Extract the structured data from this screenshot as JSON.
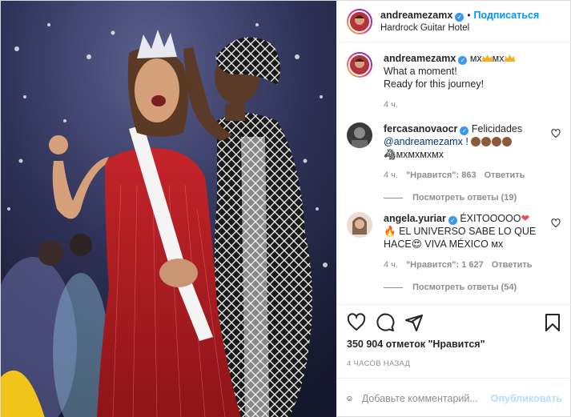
{
  "header": {
    "username": "andreamezamx",
    "separator": "•",
    "follow_label": "Подписаться",
    "location": "Hardrock Guitar Hotel"
  },
  "caption": {
    "username": "andreamezamx",
    "title_text": "мх",
    "title_text2": "мх",
    "line1": "What a moment!",
    "line2": "Ready for this journey!",
    "time": "4 ч."
  },
  "comments": [
    {
      "username": "fercasanovaocr",
      "text_start": "Felicidades",
      "mention": "@andreamezamx",
      "text_after": " !",
      "line2": "мхмхмхмх",
      "time": "4 ч.",
      "likes": "\"Нравится\": 863",
      "reply": "Ответить",
      "view_replies": "Посмотреть ответы (19)"
    },
    {
      "username": "angela.yuriar",
      "text_start": "ÉXITOOOOO",
      "line2": "EL UNIVERSO SABE LO QUE",
      "line3_a": "HACE",
      "line3_b": " VIVA MÉXICO мх",
      "time": "4 ч.",
      "likes": "\"Нравится\": 1 627",
      "reply": "Ответить",
      "view_replies": "Посмотреть ответы (54)"
    }
  ],
  "likes_text": "350 904 отметок \"Нравится\"",
  "timestamp": "4 ЧАСОВ НАЗАД",
  "add_comment": {
    "placeholder": "Добавьте комментарий...",
    "publish_label": "Опубликовать"
  },
  "colors": {
    "accent": "#0095f6",
    "verified": "#3897f0",
    "publish_disabled": "#b2dffc",
    "meta_gray": "#8e8e8e"
  },
  "icons": [
    "heart-icon",
    "comment-icon",
    "share-icon",
    "bookmark-icon",
    "emoji-icon",
    "verified-icon"
  ]
}
